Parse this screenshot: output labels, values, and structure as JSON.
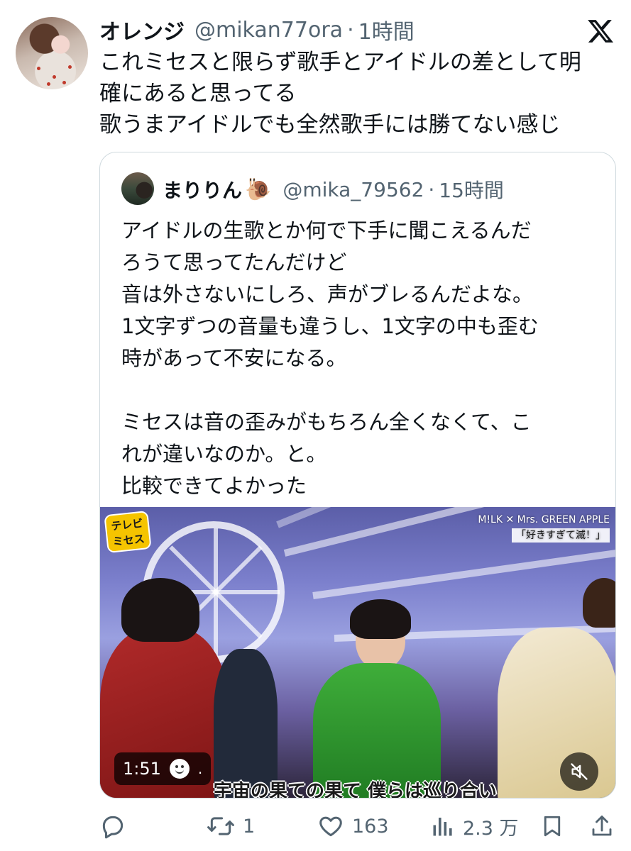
{
  "post": {
    "display_name": "オレンジ",
    "handle": "@mikan77ora",
    "separator": "·",
    "time": "1時間",
    "text_lines": [
      "これミセスと限らず歌手とアイドルの差として明",
      "確にあると思ってる",
      "歌うまアイドルでも全然歌手には勝てない感じ"
    ]
  },
  "quote": {
    "display_name": "まりりん",
    "emoji": "🐌",
    "handle": "@mika_79562",
    "separator": "·",
    "time": "15時間",
    "text_lines": [
      "アイドルの生歌とか何で下手に聞こえるんだ",
      "ろうて思ってたんだけど",
      "音は外さないにしろ、声がブレるんだよな。",
      "1文字ずつの音量も違うし、1文字の中も歪む",
      "時があって不安になる。",
      "",
      "ミセスは音の歪みがもちろん全くなくて、こ",
      "れが違いなのか。と。",
      "比較できてよかった"
    ],
    "video": {
      "tv_logo": "テレビ ミセス",
      "credit": "M!LK ✕ Mrs. GREEN APPLE",
      "song_title": "「好きすぎて滅！」",
      "subtitle": "宇宙の果ての果て 僕らは巡り合い",
      "duration": "1:51",
      "dot": "."
    }
  },
  "actions": {
    "reply_count": "",
    "retweet_count": "1",
    "like_count": "163",
    "views_count": "2.3 万"
  },
  "icons": {
    "brand": "x-logo-icon",
    "reply": "reply-icon",
    "retweet": "retweet-icon",
    "like": "heart-icon",
    "views": "views-icon",
    "bookmark": "bookmark-icon",
    "share": "share-icon",
    "mute": "mute-icon"
  },
  "colors": {
    "text": "#0f1419",
    "secondary": "#536471",
    "border": "#cfd9de"
  }
}
